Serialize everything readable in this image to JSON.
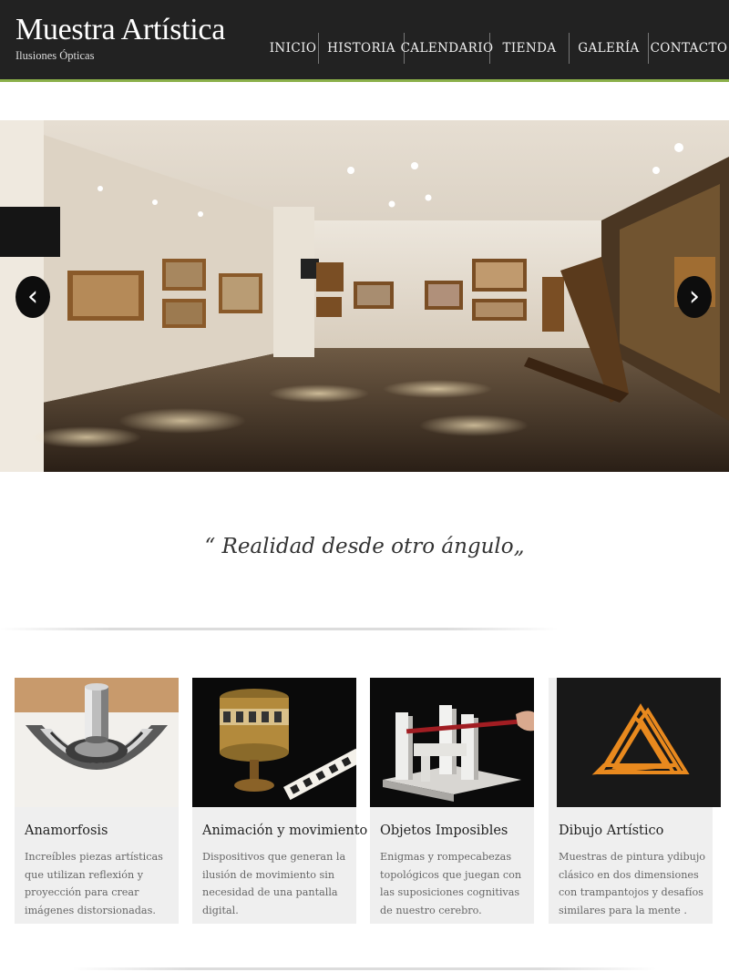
{
  "site": {
    "title": "Muestra Artística",
    "subtitle": "Ilusiones Ópticas"
  },
  "nav": {
    "items": [
      {
        "label": "INICIO"
      },
      {
        "label": "HISTORIA"
      },
      {
        "label": "CALENDARIO"
      },
      {
        "label": "TIENDA"
      },
      {
        "label": "GALERÍA"
      },
      {
        "label": "CONTACTO"
      }
    ]
  },
  "hero": {
    "prev_icon": "‹",
    "next_icon": "›",
    "image": "gallery-interior-photo"
  },
  "quote": {
    "text": "“ Realidad desde otro ángulo„"
  },
  "colors": {
    "header_bg": "#222222",
    "accent": "#8bb04a",
    "card_bg": "#efefef",
    "triangle_orange": "#e8891e"
  },
  "cards": [
    {
      "title": "Anamorfosis",
      "description": "Increíbles piezas artísticas que utilizan reflexión y proyección para crear imágenes distorsionadas.",
      "image": "anamorphic-cylinder-art"
    },
    {
      "title": "Animación y movimiento",
      "description": "Dispositivos que generan la ilusión de movimiento sin necesidad de una pantalla digital.",
      "image": "zoetrope-device"
    },
    {
      "title": "Objetos Imposibles",
      "description": "Enigmas y rompecabezas topológicos que juegan con las suposiciones cognitivas de nuestro cerebro.",
      "image": "impossible-object"
    },
    {
      "title": "Dibujo Artístico",
      "description": "Muestras de pintura ydibujo clásico en dos dimensiones con trampantojos y desafíos similares para la mente .",
      "image": "penrose-triangle"
    }
  ]
}
